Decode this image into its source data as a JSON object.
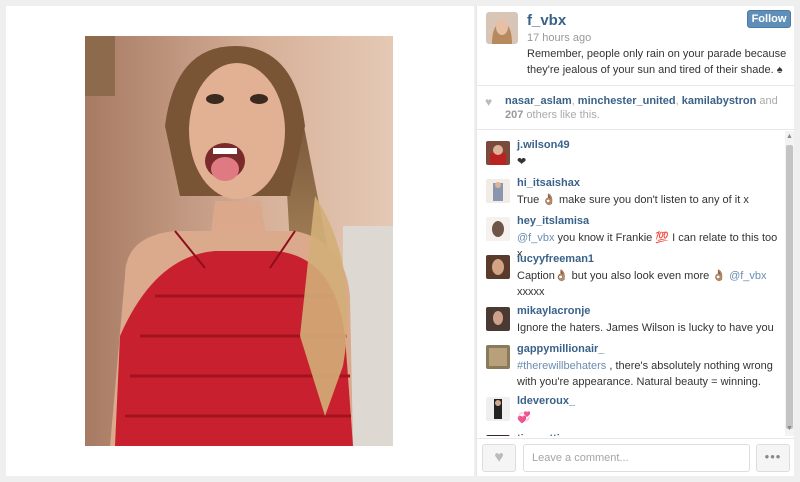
{
  "post": {
    "username": "f_vbx",
    "time": "17 hours ago",
    "caption": "Remember, people only rain on your parade because they're jealous of your sun and tired of their shade. ♠",
    "follow_label": "Follow"
  },
  "likes": {
    "users": [
      "nasar_aslam",
      "minchester_united",
      "kamilabystron"
    ],
    "sep1": ", ",
    "sep2": ", ",
    "and_text": " and ",
    "count": "207",
    "tail": " others like this."
  },
  "comments": [
    {
      "user": "j.wilson49",
      "text": "❤"
    },
    {
      "user": "hi_itsaishax",
      "text": "True 👌🏽 make sure you don't listen to any of it x"
    },
    {
      "user": "hey_itslamisa",
      "mention": "@f_vbx",
      "text": " you know it Frankie 💯 I can relate to this too x"
    },
    {
      "user": "lucyyfreeman1",
      "text_before": "Caption👌🏽 but you also look even more 👌🏽 ",
      "mention": "@f_vbx",
      "text_after": " xxxxx"
    },
    {
      "user": "mikaylacronje",
      "text": "Ignore the haters. James Wilson is lucky to have you"
    },
    {
      "user": "gappymillionair_",
      "mention": "#therewillbehaters",
      "text": " , there's absolutely nothing wrong with you're appearance. Natural beauty = winning."
    },
    {
      "user": "ldeveroux_",
      "text": "💞"
    },
    {
      "user": "tinapatti",
      "text": ""
    }
  ],
  "input": {
    "placeholder": "Leave a comment..."
  },
  "footer": {
    "more_label": "•••"
  },
  "icons": {
    "heart": "heart-icon",
    "more": "more-icon",
    "scroll_up": "scroll-up-icon",
    "scroll_down": "scroll-down-icon"
  },
  "colors": {
    "username": "#3a6289",
    "follow_bg": "#5f8fb8",
    "dress": "#c8202e"
  }
}
